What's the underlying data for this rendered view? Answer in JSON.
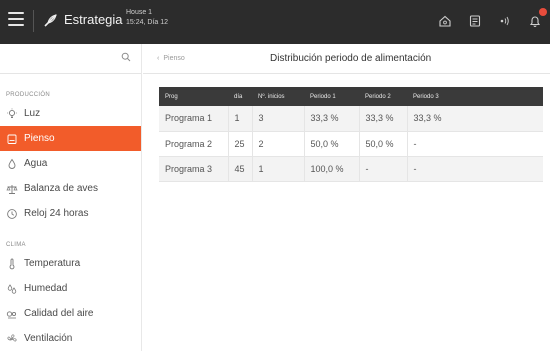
{
  "topbar": {
    "brand": "Estrategia",
    "house_line1": "House 1",
    "house_line2": "15:24, Día 12",
    "icons": [
      "menu-icon",
      "leaf-logo-icon",
      "home-icon",
      "report-icon",
      "sound-icon",
      "bell-icon"
    ],
    "badge_color": "#e74c3c"
  },
  "sidebar": {
    "section_produccion": "PRODUCCIÓN",
    "section_clima": "CLIMA",
    "produccion_items": [
      {
        "label": "Luz",
        "icon": "bulb-icon"
      },
      {
        "label": "Pienso",
        "icon": "feed-icon",
        "active": true
      },
      {
        "label": "Agua",
        "icon": "drop-icon"
      },
      {
        "label": "Balanza de aves",
        "icon": "scale-icon"
      },
      {
        "label": "Reloj 24 horas",
        "icon": "clock-icon"
      }
    ],
    "clima_items": [
      {
        "label": "Temperatura",
        "icon": "thermometer-icon"
      },
      {
        "label": "Humedad",
        "icon": "humidity-icon"
      },
      {
        "label": "Calidad del aire",
        "icon": "air-quality-icon"
      },
      {
        "label": "Ventilación",
        "icon": "fan-icon"
      }
    ],
    "active_color": "#f25c2a"
  },
  "main": {
    "breadcrumb": "Pienso",
    "title": "Distribución periodo de alimentación",
    "table": {
      "headers": [
        "Prog",
        "día",
        "Nº. inicios",
        "Periodo 1",
        "Periodo 2",
        "Periodo 3"
      ],
      "rows": [
        [
          "Programa 1",
          "1",
          "3",
          "33,3 %",
          "33,3 %",
          "33,3 %"
        ],
        [
          "Programa 2",
          "25",
          "2",
          "50,0 %",
          "50,0 %",
          "-"
        ],
        [
          "Programa 3",
          "45",
          "1",
          "100,0 %",
          "-",
          "-"
        ]
      ]
    }
  }
}
